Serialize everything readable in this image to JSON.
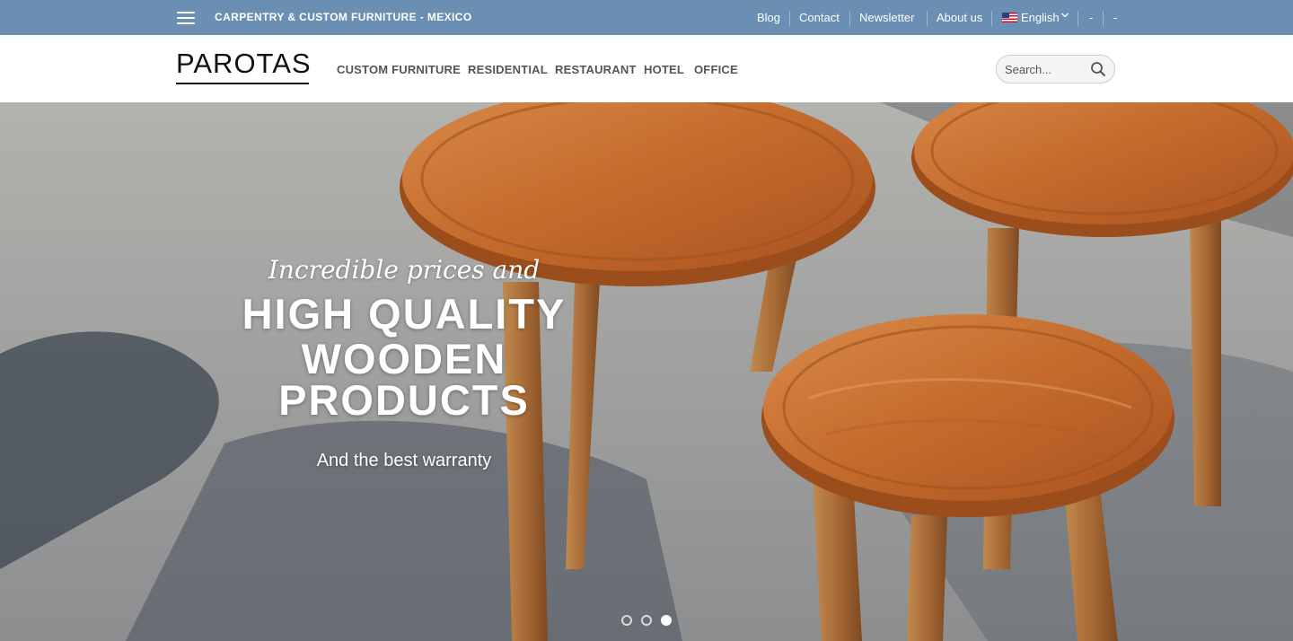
{
  "topbar": {
    "tagline": "CARPENTRY & CUSTOM FURNITURE - MEXICO",
    "links": [
      "Blog",
      "Contact",
      "Newsletter",
      "About us"
    ],
    "language": "English",
    "extra1": "-",
    "extra2": "-",
    "background_color": "#6a8fb2"
  },
  "header": {
    "logo": "PAROTAS",
    "nav": [
      "CUSTOM FURNITURE",
      "RESIDENTIAL",
      "RESTAURANT",
      "HOTEL",
      "OFFICE"
    ],
    "search_placeholder": "Search..."
  },
  "hero": {
    "script": "Incredible prices and",
    "headline_1": "HIGH QUALITY",
    "headline_2": "WOODEN",
    "headline_3": "PRODUCTS",
    "subline": "And the best warranty",
    "slides_total": 3,
    "active_slide": 3
  },
  "icons": {
    "menu": "hamburger-menu-icon",
    "flag": "us-flag-icon",
    "dropdown": "chevron-down-icon",
    "search": "search-icon"
  }
}
